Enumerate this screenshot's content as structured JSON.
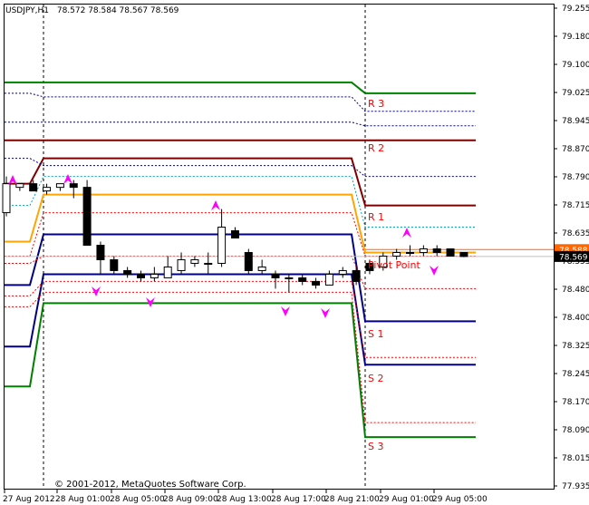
{
  "header": {
    "symbol": "USDJPY,H1",
    "quotes": "78.572 78.584 78.567 78.569"
  },
  "copyright": "© 2001-2012, MetaQuotes Software Corp.",
  "colors": {
    "bull_body": "#ffffff",
    "bear_body": "#000000",
    "r3": "#008000",
    "r2": "#800000",
    "r1": "#800000",
    "pivot": "#ffa500",
    "s1": "#000080",
    "s2": "#000080",
    "s3": "#008000",
    "level_label": "#ff0000",
    "fractal": "#ff00ff",
    "price_line": "#ff6600",
    "price_tag_bg": "#ff6600",
    "current_tag_bg": "#000000"
  },
  "chart_data": {
    "type": "candlestick",
    "y_ticks": [
      "79.255",
      "79.180",
      "79.100",
      "79.025",
      "78.945",
      "78.870",
      "78.790",
      "78.715",
      "78.635",
      "78.555",
      "78.480",
      "78.400",
      "78.325",
      "78.245",
      "78.170",
      "78.090",
      "78.015",
      "77.935"
    ],
    "ylim": [
      77.935,
      79.255
    ],
    "x_ticks": [
      "27 Aug 2012",
      "28 Aug 01:00",
      "28 Aug 05:00",
      "28 Aug 09:00",
      "28 Aug 13:00",
      "28 Aug 17:00",
      "28 Aug 21:00",
      "29 Aug 01:00",
      "29 Aug 05:00"
    ],
    "price_tags": [
      {
        "value": "78.588",
        "price": 78.588
      },
      {
        "value": "78.569",
        "price": 78.569
      }
    ],
    "level_labels": [
      "R 3",
      "R 2",
      "R 1",
      "Pivot Point",
      "S 1",
      "S 2",
      "S 3"
    ],
    "pivot_levels": {
      "prev": {
        "R3": 79.05,
        "R2": 78.89,
        "R1": 78.77,
        "Pivot": 78.61,
        "S1": 78.49,
        "S2": 78.32,
        "S3": 78.21
      },
      "day28": {
        "R3": 79.05,
        "R2": 78.89,
        "R1": 78.84,
        "Pivot": 78.74,
        "S1": 78.63,
        "S2": 78.52,
        "S3": 78.44
      },
      "day29": {
        "R3": 79.02,
        "R2": 78.89,
        "R1": 78.71,
        "Pivot": 78.58,
        "S1": 78.39,
        "S2": 78.27,
        "S3": 78.07
      }
    },
    "candles": [
      {
        "o": 78.69,
        "h": 78.79,
        "l": 78.68,
        "c": 78.77
      },
      {
        "o": 78.76,
        "h": 78.77,
        "l": 78.75,
        "c": 78.77
      },
      {
        "o": 78.77,
        "h": 78.78,
        "l": 78.75,
        "c": 78.75
      },
      {
        "o": 78.75,
        "h": 78.77,
        "l": 78.74,
        "c": 78.76
      },
      {
        "o": 78.76,
        "h": 78.77,
        "l": 78.75,
        "c": 78.77
      },
      {
        "o": 78.77,
        "h": 78.78,
        "l": 78.73,
        "c": 78.76
      },
      {
        "o": 78.76,
        "h": 78.78,
        "l": 78.6,
        "c": 78.6
      },
      {
        "o": 78.6,
        "h": 78.61,
        "l": 78.52,
        "c": 78.56
      },
      {
        "o": 78.56,
        "h": 78.57,
        "l": 78.52,
        "c": 78.53
      },
      {
        "o": 78.53,
        "h": 78.54,
        "l": 78.51,
        "c": 78.52
      },
      {
        "o": 78.52,
        "h": 78.53,
        "l": 78.5,
        "c": 78.51
      },
      {
        "o": 78.51,
        "h": 78.54,
        "l": 78.5,
        "c": 78.52
      },
      {
        "o": 78.51,
        "h": 78.57,
        "l": 78.51,
        "c": 78.54
      },
      {
        "o": 78.53,
        "h": 78.58,
        "l": 78.52,
        "c": 78.56
      },
      {
        "o": 78.55,
        "h": 78.57,
        "l": 78.54,
        "c": 78.56
      },
      {
        "o": 78.55,
        "h": 78.58,
        "l": 78.52,
        "c": 78.55
      },
      {
        "o": 78.55,
        "h": 78.7,
        "l": 78.54,
        "c": 78.65
      },
      {
        "o": 78.64,
        "h": 78.65,
        "l": 78.62,
        "c": 78.62
      },
      {
        "o": 78.58,
        "h": 78.59,
        "l": 78.52,
        "c": 78.53
      },
      {
        "o": 78.53,
        "h": 78.56,
        "l": 78.52,
        "c": 78.54
      },
      {
        "o": 78.52,
        "h": 78.53,
        "l": 78.48,
        "c": 78.51
      },
      {
        "o": 78.51,
        "h": 78.52,
        "l": 78.47,
        "c": 78.51
      },
      {
        "o": 78.51,
        "h": 78.52,
        "l": 78.49,
        "c": 78.5
      },
      {
        "o": 78.5,
        "h": 78.51,
        "l": 78.48,
        "c": 78.49
      },
      {
        "o": 78.49,
        "h": 78.53,
        "l": 78.49,
        "c": 78.52
      },
      {
        "o": 78.52,
        "h": 78.54,
        "l": 78.51,
        "c": 78.53
      },
      {
        "o": 78.53,
        "h": 78.54,
        "l": 78.49,
        "c": 78.5
      },
      {
        "o": 78.55,
        "h": 78.56,
        "l": 78.52,
        "c": 78.53
      },
      {
        "o": 78.54,
        "h": 78.58,
        "l": 78.53,
        "c": 78.57
      },
      {
        "o": 78.57,
        "h": 78.59,
        "l": 78.56,
        "c": 78.58
      },
      {
        "o": 78.58,
        "h": 78.6,
        "l": 78.57,
        "c": 78.58
      },
      {
        "o": 78.58,
        "h": 78.6,
        "l": 78.57,
        "c": 78.59
      },
      {
        "o": 78.59,
        "h": 78.6,
        "l": 78.57,
        "c": 78.58
      },
      {
        "o": 78.59,
        "h": 78.59,
        "l": 78.57,
        "c": 78.57
      },
      {
        "o": 78.58,
        "h": 78.58,
        "l": 78.567,
        "c": 78.569
      }
    ]
  }
}
